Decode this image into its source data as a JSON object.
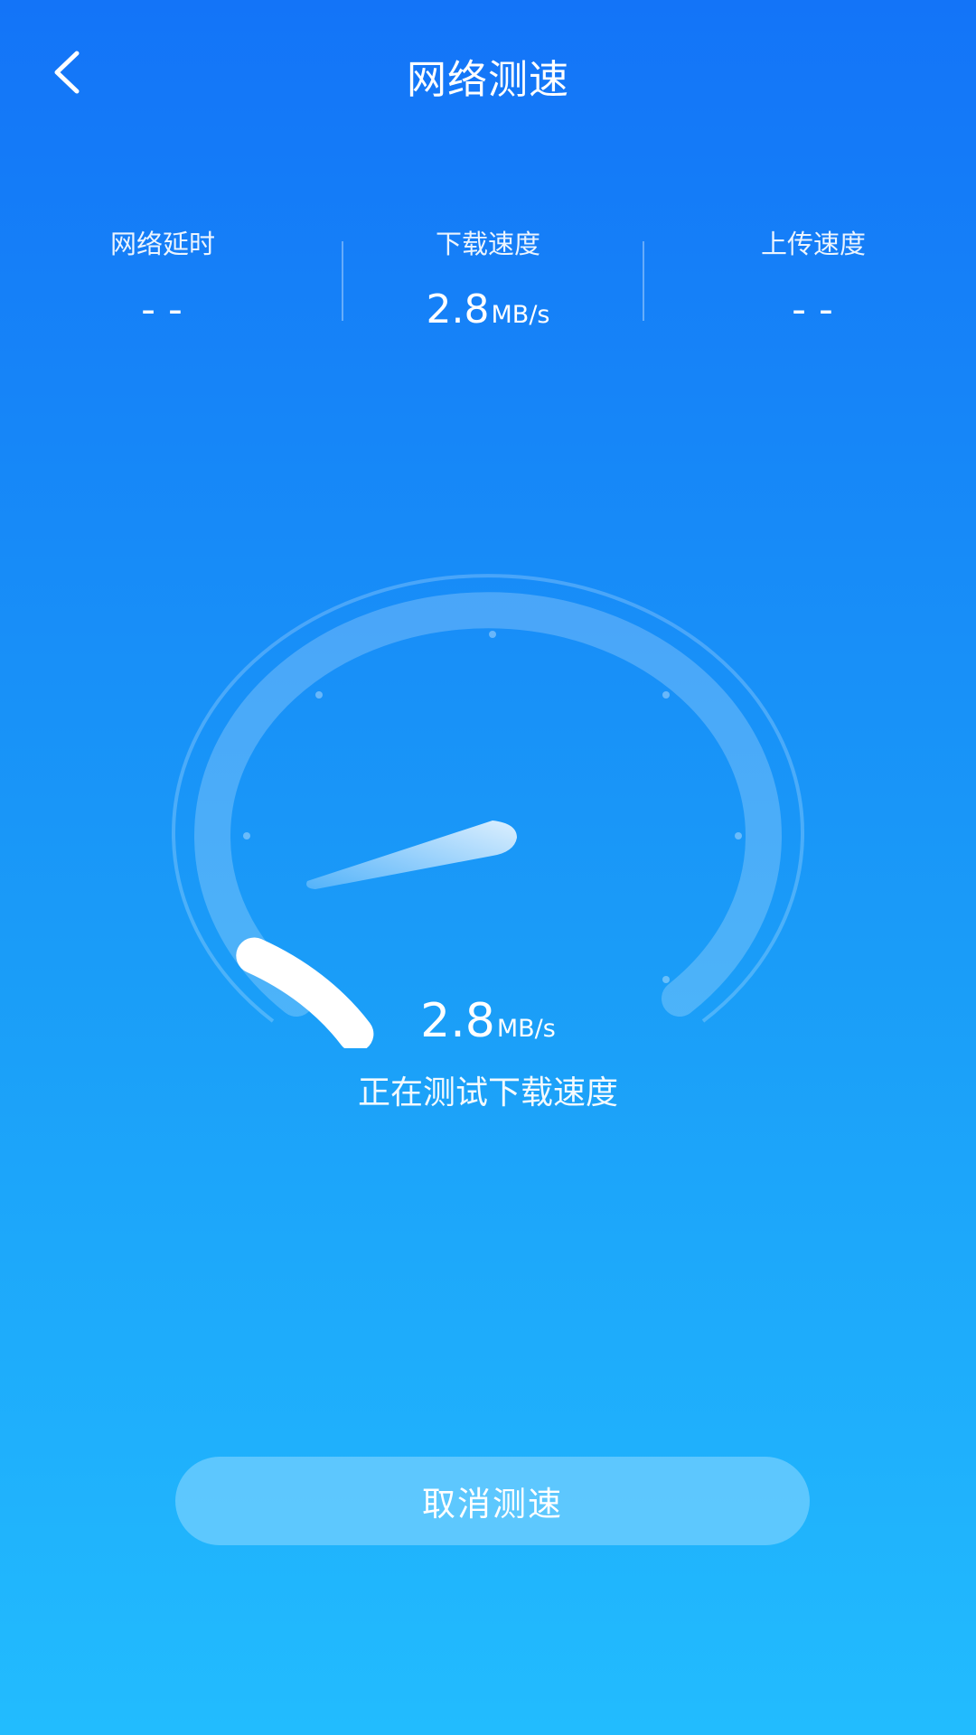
{
  "header": {
    "title": "网络测速"
  },
  "stats": [
    {
      "label": "网络延时",
      "value": "- -",
      "unit": ""
    },
    {
      "label": "下载速度",
      "value": "2.8",
      "unit": "MB/s"
    },
    {
      "label": "上传速度",
      "value": "- -",
      "unit": ""
    }
  ],
  "gauge": {
    "value": "2.8",
    "unit": "MB/s",
    "status": "正在测试下载速度",
    "progress": 0.12
  },
  "actions": {
    "cancel_label": "取消测速"
  },
  "colors": {
    "bg_top": "#1374f8",
    "bg_bottom": "#22bcfe",
    "accent": "#ffffff"
  }
}
